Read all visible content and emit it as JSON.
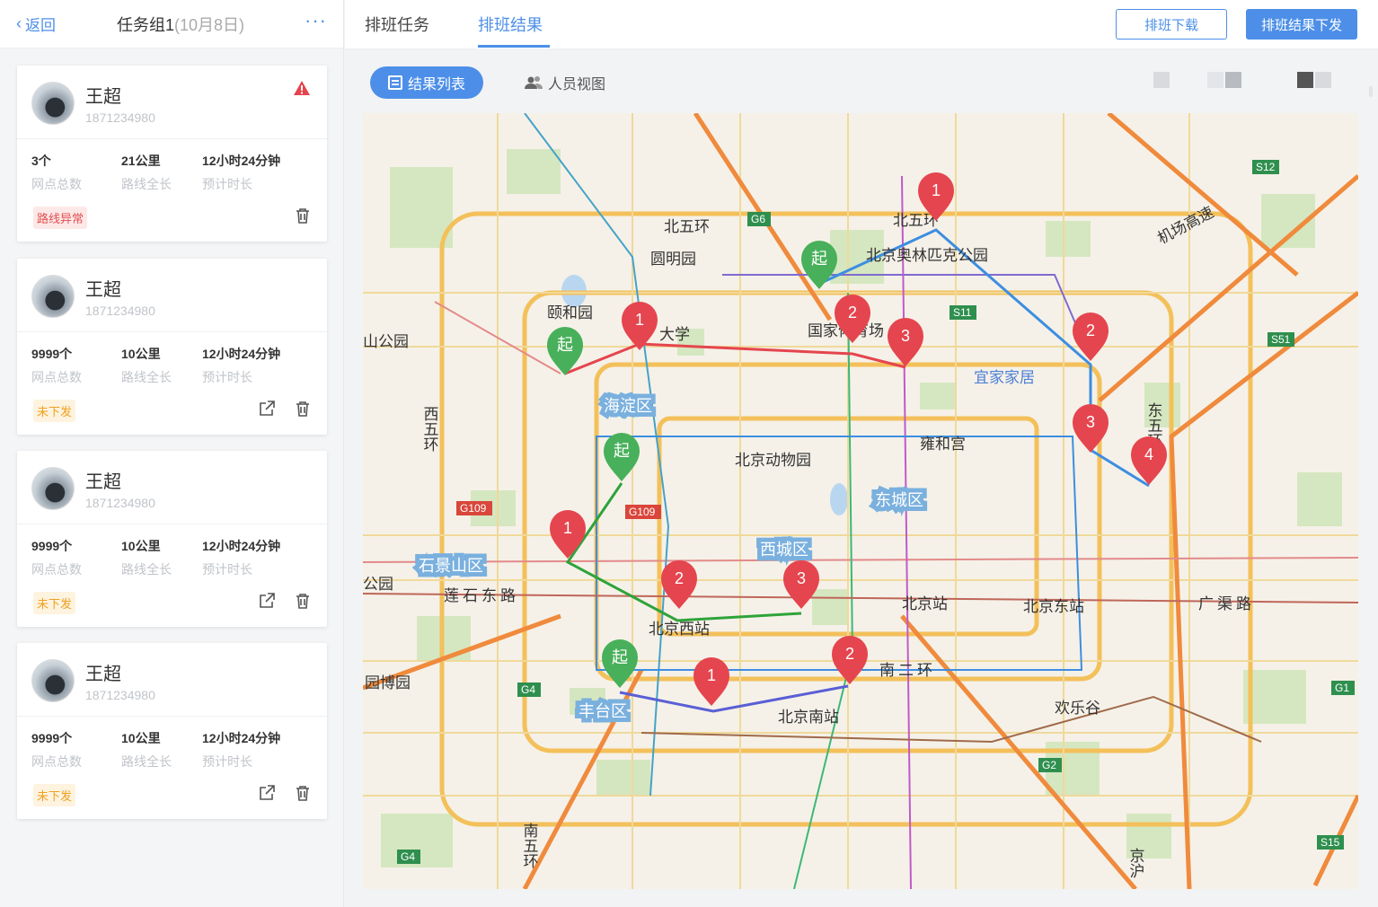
{
  "sidebar": {
    "back_label": "返回",
    "group_title": "任务组1",
    "group_date": "(10月8日)",
    "more_label": "···",
    "cards": [
      {
        "name": "王超",
        "phone": "1871234980",
        "points": "3个",
        "points_label": "网点总数",
        "distance": "21公里",
        "distance_label": "路线全长",
        "duration": "12小时24分钟",
        "duration_label": "预计时长",
        "status": "路线异常",
        "status_type": "error",
        "warning": true
      },
      {
        "name": "王超",
        "phone": "1871234980",
        "points": "9999个",
        "points_label": "网点总数",
        "distance": "10公里",
        "distance_label": "路线全长",
        "duration": "12小时24分钟",
        "duration_label": "预计时长",
        "status": "未下发",
        "status_type": "pending",
        "warning": false
      },
      {
        "name": "王超",
        "phone": "1871234980",
        "points": "9999个",
        "points_label": "网点总数",
        "distance": "10公里",
        "distance_label": "路线全长",
        "duration": "12小时24分钟",
        "duration_label": "预计时长",
        "status": "未下发",
        "status_type": "pending",
        "warning": false
      },
      {
        "name": "王超",
        "phone": "1871234980",
        "points": "9999个",
        "points_label": "网点总数",
        "distance": "10公里",
        "distance_label": "路线全长",
        "duration": "12小时24分钟",
        "duration_label": "预计时长",
        "status": "未下发",
        "status_type": "pending",
        "warning": false
      }
    ]
  },
  "header": {
    "tabs": [
      {
        "label": "排班任务",
        "active": false
      },
      {
        "label": "排班结果",
        "active": true
      }
    ],
    "download_label": "排班下载",
    "publish_label": "排班结果下发"
  },
  "view": {
    "list_label": "结果列表",
    "people_label": "人员视图"
  },
  "map": {
    "place_labels": [
      "北五环",
      "北五环",
      "圆明园",
      "颐和园",
      "北京奥林匹克公园",
      "国家体育场",
      "大学",
      "山公园",
      "海淀区",
      "西五环",
      "北京动物园",
      "雍和宫",
      "宜家家居",
      "东五环",
      "机场高速",
      "东城区",
      "西城区",
      "石景山区",
      "莲石东路",
      "北京西站",
      "北京站",
      "北京东站",
      "广渠路",
      "南二环",
      "北京南站",
      "丰台区",
      "欢乐谷",
      "园博园",
      "公园",
      "南五环",
      "京沪"
    ],
    "road_shields": [
      "G6",
      "S12",
      "S11",
      "S51",
      "G109",
      "G109",
      "G4",
      "G1",
      "G2",
      "S15",
      "G4"
    ],
    "start_marker_label": "起",
    "routes": [
      {
        "color": "#e5454e",
        "stops": [
          "起",
          "1",
          "2",
          "3"
        ]
      },
      {
        "color": "#3d8ee0",
        "stops": [
          "起",
          "1",
          "2",
          "3",
          "4"
        ]
      },
      {
        "color": "#2fa33a",
        "stops": [
          "起",
          "1",
          "2",
          "3"
        ]
      },
      {
        "color": "#5a5fd6",
        "stops": [
          "起",
          "1",
          "2"
        ]
      }
    ]
  }
}
